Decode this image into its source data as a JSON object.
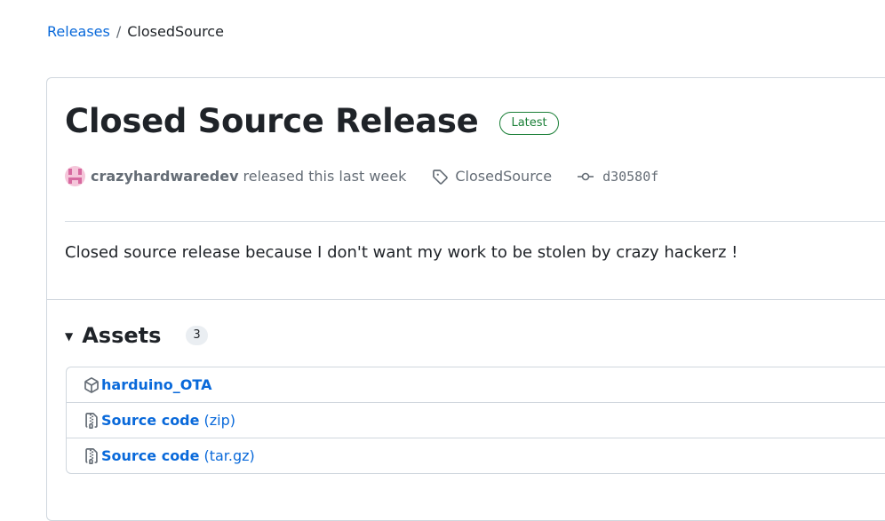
{
  "breadcrumb": {
    "parent": "Releases",
    "separator": "/",
    "current": "ClosedSource"
  },
  "release": {
    "title": "Closed Source Release",
    "badge": "Latest",
    "author": "crazyhardwaredev",
    "released_text": "released this last week",
    "tag": "ClosedSource",
    "commit": "d30580f",
    "description": "Closed source release because I don't want my work to be stolen by crazy hackerz !"
  },
  "assets": {
    "title": "Assets",
    "count": "3",
    "items": [
      {
        "name": "harduino_OTA",
        "ext": "",
        "icon": "package-icon"
      },
      {
        "name": "Source code",
        "ext": "(zip)",
        "icon": "file-zip-icon"
      },
      {
        "name": "Source code",
        "ext": "(tar.gz)",
        "icon": "file-zip-icon"
      }
    ]
  },
  "colors": {
    "link": "#0969da",
    "latest_badge": "#1a7f37",
    "muted": "#656d76",
    "border": "#d0d7de"
  }
}
